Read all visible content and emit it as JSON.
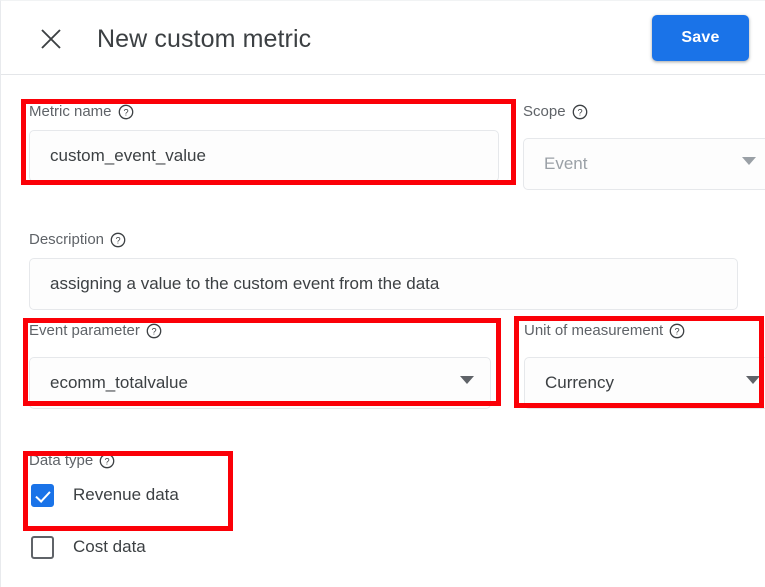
{
  "header": {
    "title": "New custom metric",
    "close_icon": "close-icon",
    "save_label": "Save"
  },
  "colors": {
    "accent": "#1a73e8",
    "annotation": "#fb0007",
    "label_text": "#5f6368",
    "value_text": "#3c4043",
    "disabled_text": "#9aa0a6"
  },
  "fields": {
    "metric_name": {
      "label": "Metric name",
      "help_icon": "help-circle-icon",
      "value": "custom_event_value",
      "placeholder": "Metric name"
    },
    "scope": {
      "label": "Scope",
      "help_icon": "help-circle-icon",
      "value": "Event",
      "disabled": true,
      "caret_icon": "chevron-down-icon"
    },
    "description": {
      "label": "Description",
      "help_icon": "help-circle-icon",
      "value": "assigning a value to the custom event from the data",
      "placeholder": "Description"
    },
    "event_parameter": {
      "label": "Event parameter",
      "help_icon": "help-circle-icon",
      "value": "ecomm_totalvalue",
      "caret_icon": "chevron-down-icon"
    },
    "unit_of_measurement": {
      "label": "Unit of measurement",
      "help_icon": "help-circle-icon",
      "value": "Currency",
      "caret_icon": "chevron-down-icon"
    },
    "data_type": {
      "label": "Data type",
      "help_icon": "help-circle-icon",
      "options": [
        {
          "label": "Revenue data",
          "checked": true
        },
        {
          "label": "Cost data",
          "checked": false
        }
      ]
    }
  }
}
